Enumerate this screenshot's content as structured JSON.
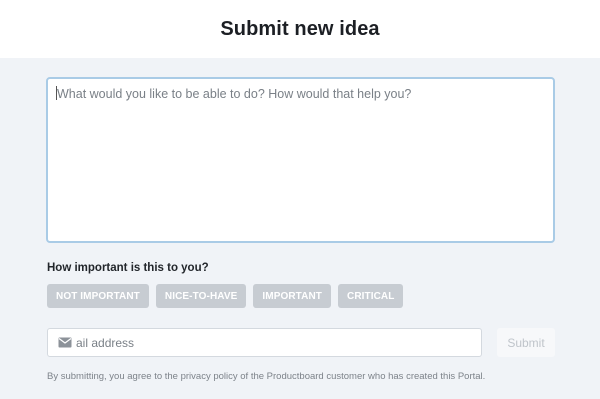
{
  "header": {
    "title": "Submit new idea"
  },
  "idea": {
    "placeholder": "What would you like to be able to do? How would that help you?",
    "value": ""
  },
  "importance": {
    "label": "How important is this to you?",
    "options": [
      "NOT IMPORTANT",
      "NICE-TO-HAVE",
      "IMPORTANT",
      "CRITICAL"
    ]
  },
  "email": {
    "placeholder": "ail address",
    "icon": "envelope-icon"
  },
  "submit": {
    "label": "Submit"
  },
  "disclaimer": "By submitting, you agree to the privacy policy of the Productboard customer who has created this Portal.",
  "colors": {
    "background": "#f0f3f7",
    "chip": "#c7ccd2",
    "focus_border": "#a9cbe6"
  }
}
